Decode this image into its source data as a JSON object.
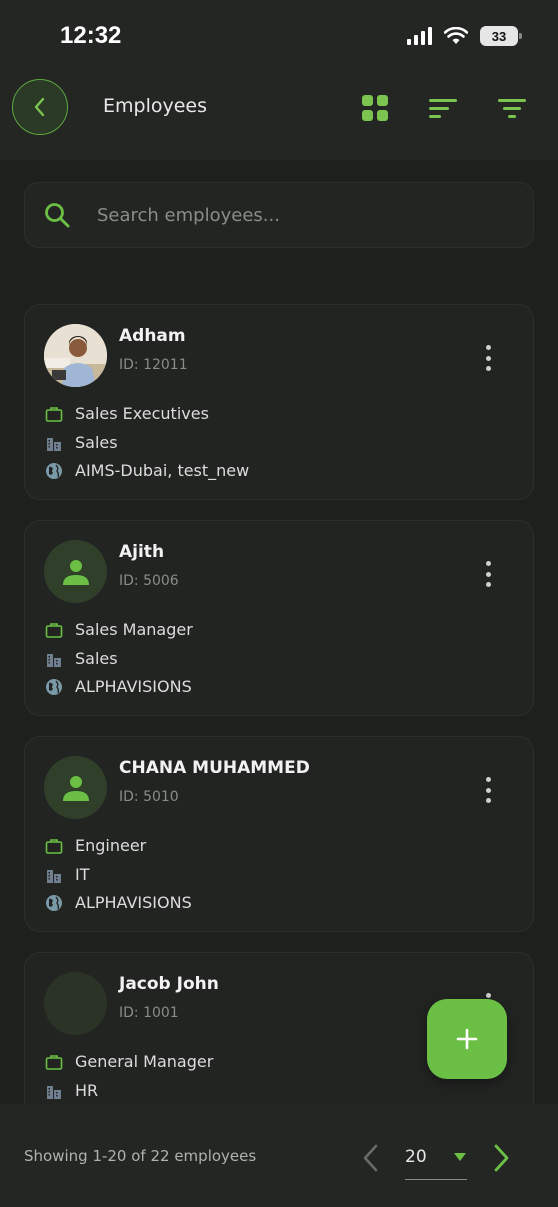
{
  "status_bar": {
    "time": "12:32",
    "battery": "33"
  },
  "header": {
    "title": "Employees"
  },
  "search": {
    "placeholder": "Search employees..."
  },
  "employees": [
    {
      "name": "Adham",
      "id": "ID: 12011",
      "designation": "Sales Executives",
      "department": "Sales",
      "location": "AIMS-Dubai, test_new",
      "avatar": "photo"
    },
    {
      "name": "Ajith",
      "id": "ID: 5006",
      "designation": "Sales Manager",
      "department": "Sales",
      "location": "ALPHAVISIONS",
      "avatar": "person-icon"
    },
    {
      "name": "CHANA MUHAMMED",
      "id": "ID: 5010",
      "designation": "Engineer",
      "department": "IT",
      "location": "ALPHAVISIONS",
      "avatar": "person-icon"
    },
    {
      "name": "Jacob John",
      "id": "ID: 1001",
      "designation": "General Manager",
      "department": "HR",
      "location": "",
      "avatar": "empty"
    }
  ],
  "footer": {
    "showing_text": "Showing 1-20 of 22 employees",
    "page_size": "20"
  },
  "colors": {
    "accent": "#6cbf45",
    "background": "#1e201e",
    "card": "#222422",
    "dept_icon": "#7a8a9a"
  }
}
